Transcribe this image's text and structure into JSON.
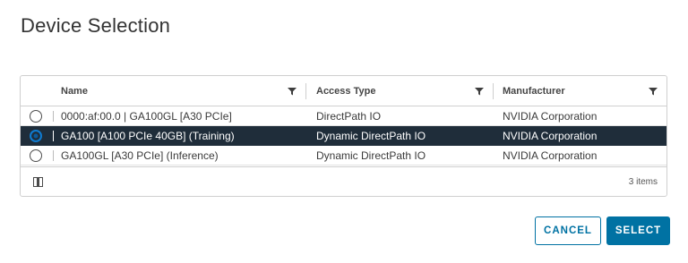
{
  "dialog": {
    "title": "Device Selection"
  },
  "table": {
    "columns": [
      {
        "label": "Name"
      },
      {
        "label": "Access Type"
      },
      {
        "label": "Manufacturer"
      }
    ],
    "rows": [
      {
        "name": "0000:af:00.0 | GA100GL [A30 PCIe]",
        "access_type": "DirectPath IO",
        "manufacturer": "NVIDIA Corporation",
        "selected": false
      },
      {
        "name": "GA100 [A100 PCIe 40GB] (Training)",
        "access_type": "Dynamic DirectPath IO",
        "manufacturer": "NVIDIA Corporation",
        "selected": true
      },
      {
        "name": "GA100GL [A30 PCIe] (Inference)",
        "access_type": "Dynamic DirectPath IO",
        "manufacturer": "NVIDIA Corporation",
        "selected": false
      }
    ],
    "footer": {
      "item_count": "3 items"
    }
  },
  "buttons": {
    "cancel": "CANCEL",
    "select": "SELECT"
  },
  "colors": {
    "accent": "#0072a3",
    "selected_row": "#1f2d3a",
    "radio_selected": "#0f7bd0"
  },
  "icons": {
    "filter": "filter-icon",
    "column_toggle": "column-toggle-icon"
  }
}
